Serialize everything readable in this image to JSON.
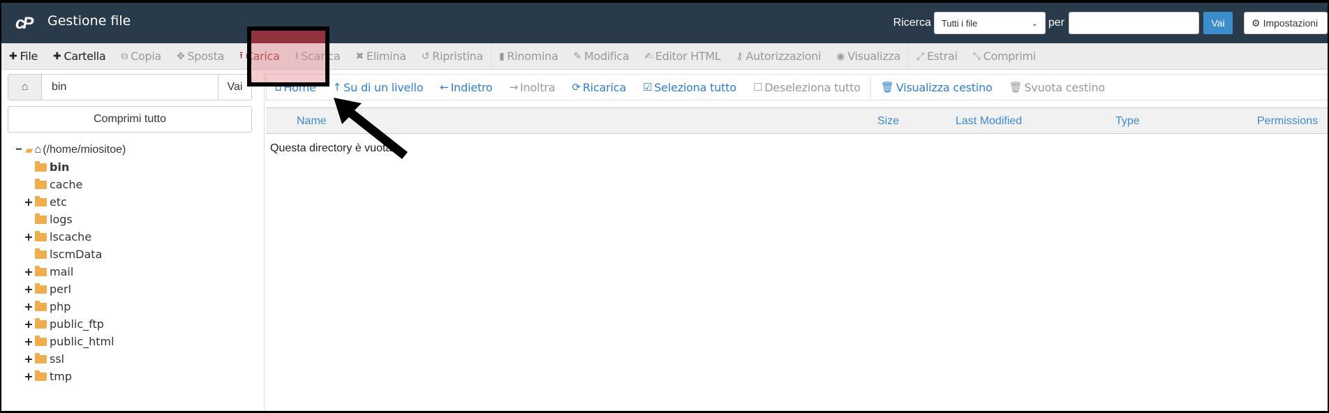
{
  "header": {
    "logo": "cP",
    "title": "Gestione file",
    "search_label": "Ricerca",
    "search_scope": "Tutti i file",
    "for_label": "per",
    "search_value": "",
    "go_label": "Vai",
    "settings_label": "Impostazioni"
  },
  "toolbar": {
    "items": [
      {
        "label": "File",
        "icon": "plus-icon",
        "glyph": "✚",
        "enabled": true
      },
      {
        "label": "Cartella",
        "icon": "plus-icon",
        "glyph": "✚",
        "enabled": true
      },
      {
        "label": "Copia",
        "icon": "copy-icon",
        "glyph": "⧉",
        "enabled": false
      },
      {
        "label": "Sposta",
        "icon": "move-icon",
        "glyph": "✥",
        "enabled": false
      },
      {
        "label": "Carica",
        "icon": "upload-icon",
        "glyph": "⭱",
        "enabled": true,
        "highlighted": true
      },
      {
        "label": "Scarica",
        "icon": "download-icon",
        "glyph": "⭳",
        "enabled": false
      },
      {
        "label": "Elimina",
        "icon": "delete-icon",
        "glyph": "✖",
        "enabled": false
      },
      {
        "label": "Ripristina",
        "icon": "restore-icon",
        "glyph": "↺",
        "enabled": false
      },
      {
        "label": "Rinomina",
        "icon": "file-icon",
        "glyph": "▮",
        "enabled": false
      },
      {
        "label": "Modifica",
        "icon": "pencil-icon",
        "glyph": "✎",
        "enabled": false
      },
      {
        "label": "Editor HTML",
        "icon": "edit-icon",
        "glyph": "✍",
        "enabled": false
      },
      {
        "label": "Autorizzazioni",
        "icon": "key-icon",
        "glyph": "⚷",
        "enabled": false
      },
      {
        "label": "Visualizza",
        "icon": "eye-icon",
        "glyph": "◉",
        "enabled": false
      },
      {
        "label": "Estrai",
        "icon": "expand-icon",
        "glyph": "⤢",
        "enabled": false
      },
      {
        "label": "Comprimi",
        "icon": "compress-icon",
        "glyph": "⤡",
        "enabled": false
      }
    ],
    "highlight_color": "#923340"
  },
  "sidebar": {
    "path_value": "bin",
    "go_label": "Vai",
    "collapse_label": "Comprimi tutto",
    "root_label": "(/home/miositoe)",
    "folders": [
      {
        "name": "bin",
        "expandable": false,
        "selected": true
      },
      {
        "name": "cache",
        "expandable": false,
        "selected": false
      },
      {
        "name": "etc",
        "expandable": true,
        "selected": false
      },
      {
        "name": "logs",
        "expandable": false,
        "selected": false
      },
      {
        "name": "lscache",
        "expandable": true,
        "selected": false
      },
      {
        "name": "lscmData",
        "expandable": false,
        "selected": false
      },
      {
        "name": "mail",
        "expandable": true,
        "selected": false
      },
      {
        "name": "perl",
        "expandable": true,
        "selected": false
      },
      {
        "name": "php",
        "expandable": true,
        "selected": false
      },
      {
        "name": "public_ftp",
        "expandable": true,
        "selected": false
      },
      {
        "name": "public_html",
        "expandable": true,
        "selected": false
      },
      {
        "name": "ssl",
        "expandable": true,
        "selected": false
      },
      {
        "name": "tmp",
        "expandable": true,
        "selected": false
      }
    ]
  },
  "navbar": {
    "home": "Home",
    "up": "Su di un livello",
    "back": "Indietro",
    "forward": "Inoltra",
    "reload": "Ricarica",
    "select_all": "Seleziona tutto",
    "deselect_all": "Deseleziona tutto",
    "view_trash": "Visualizza cestino",
    "empty_trash": "Svuota cestino"
  },
  "table": {
    "columns": [
      "Name",
      "Size",
      "Last Modified",
      "Type",
      "Permissions"
    ],
    "empty_message": "Questa directory è vuota."
  }
}
